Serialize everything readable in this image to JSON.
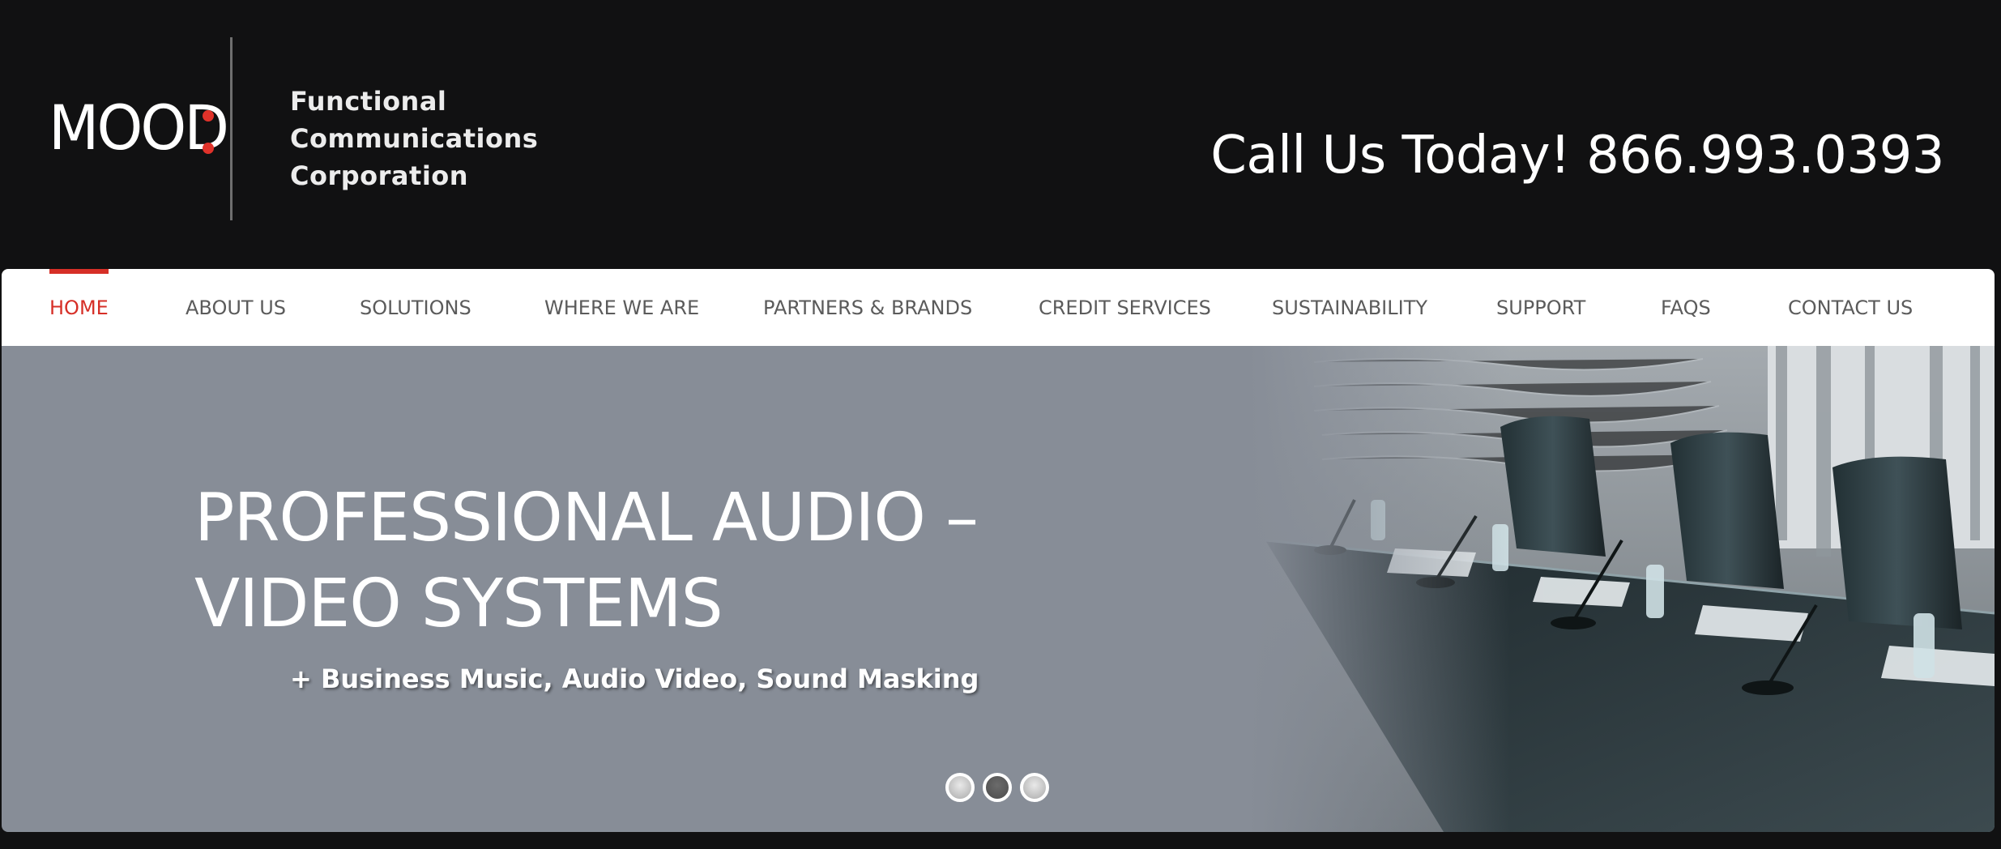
{
  "header": {
    "logo": {
      "wordmark": "MOOD",
      "tagline_lines": [
        "Functional",
        "Communications",
        "Corporation"
      ],
      "accent_color": "#e0322a"
    },
    "call_us": "Call Us Today! 866.993.0393"
  },
  "nav": {
    "active_color": "#d62f27",
    "items": [
      {
        "label": "HOME",
        "active": true
      },
      {
        "label": "ABOUT US",
        "active": false
      },
      {
        "label": "SOLUTIONS",
        "active": false
      },
      {
        "label": "WHERE WE ARE",
        "active": false
      },
      {
        "label": "PARTNERS & BRANDS",
        "active": false
      },
      {
        "label": "CREDIT SERVICES",
        "active": false
      },
      {
        "label": "SUSTAINABILITY",
        "active": false
      },
      {
        "label": "SUPPORT",
        "active": false
      },
      {
        "label": "FAQS",
        "active": false
      },
      {
        "label": "CONTACT US",
        "active": false
      }
    ]
  },
  "hero": {
    "title_lines": [
      "PROFESSIONAL AUDIO –",
      "VIDEO SYSTEMS"
    ],
    "subtitle": "+ Business Music, Audio Video, Sound Masking",
    "background_color": "#878d97",
    "slides": {
      "count": 3,
      "active_index": 1
    }
  }
}
